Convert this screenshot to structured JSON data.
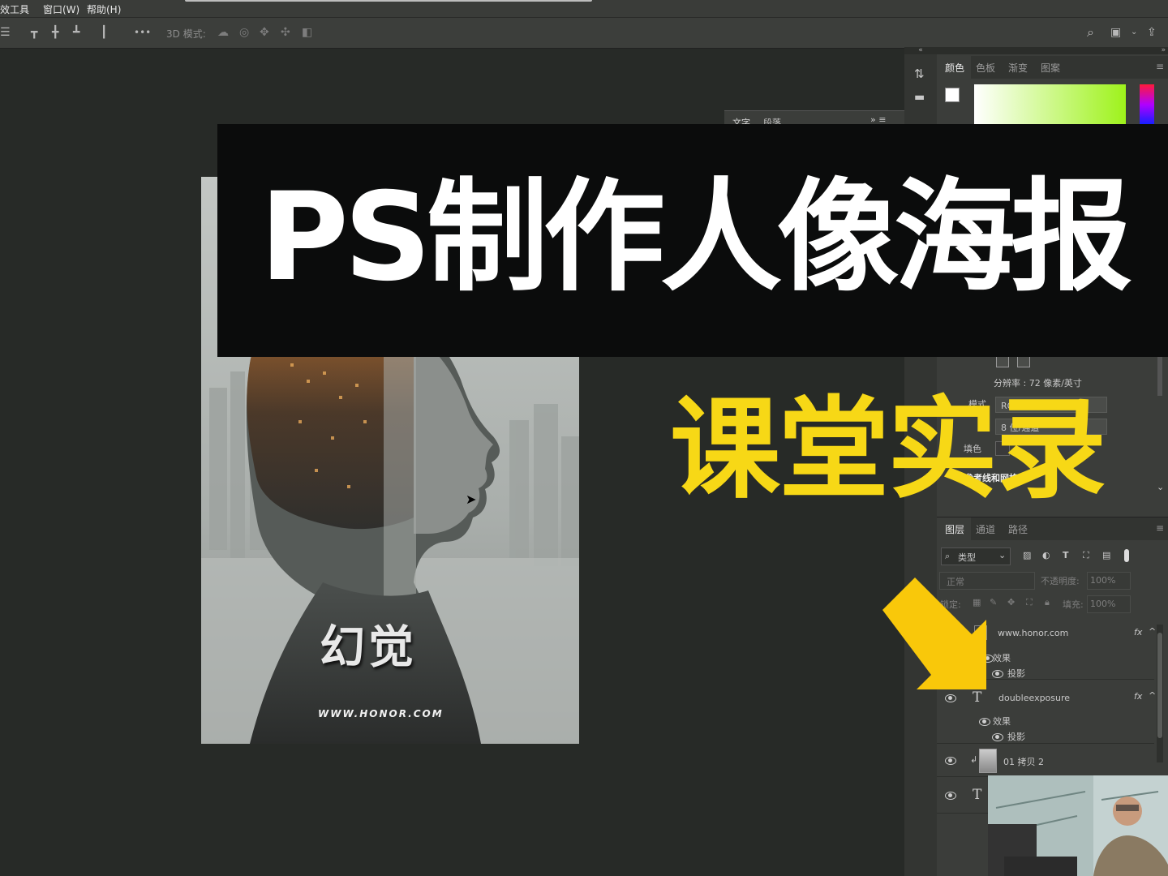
{
  "menubar": {
    "items": [
      "效工具",
      "窗口(W)",
      "帮助(H)"
    ]
  },
  "optionsbar": {
    "mode3d_label": "3D 模式:",
    "more_label": "•••"
  },
  "banner": {
    "title": "PS制作人像海报",
    "subtitle": "课堂实录"
  },
  "color_panel": {
    "tabs": [
      "颜色",
      "色板",
      "渐变",
      "图案"
    ]
  },
  "character_panel": {
    "tabs": [
      "文字",
      "段落"
    ]
  },
  "properties_panel": {
    "resolution": "分辨率 : 72 像素/英寸",
    "mode_label": "模式",
    "mode_value": "RGB 颜色",
    "depth_value": "8 位/通道",
    "fill_label": "填色",
    "guides_label": "参考线和网格"
  },
  "layers_panel": {
    "tabs": [
      "图层",
      "通道",
      "路径"
    ],
    "filter_kind": "类型",
    "blend_mode": "正常",
    "opacity_label": "不透明度:",
    "opacity_value": "100%",
    "lock_label": "锁定:",
    "fill_label": "填充:",
    "fill_value": "100%",
    "layers": [
      {
        "name": "www.honor.com",
        "type": "text",
        "fx": "fx",
        "effects_label": "效果",
        "effect": "投影"
      },
      {
        "name": "doubleexposure",
        "type": "text",
        "fx": "fx",
        "effects_label": "效果",
        "effect": "投影"
      },
      {
        "name": "01 拷贝 2",
        "type": "image"
      },
      {
        "name": "",
        "type": "text"
      }
    ]
  },
  "poster": {
    "title": "幻觉",
    "url": "WWW.HONOR.COM"
  },
  "colors": {
    "accent_yellow": "#f7d816",
    "arrow_yellow": "#f9c80a",
    "ui_dark": "#272a27",
    "panel": "#3b3d3a"
  }
}
